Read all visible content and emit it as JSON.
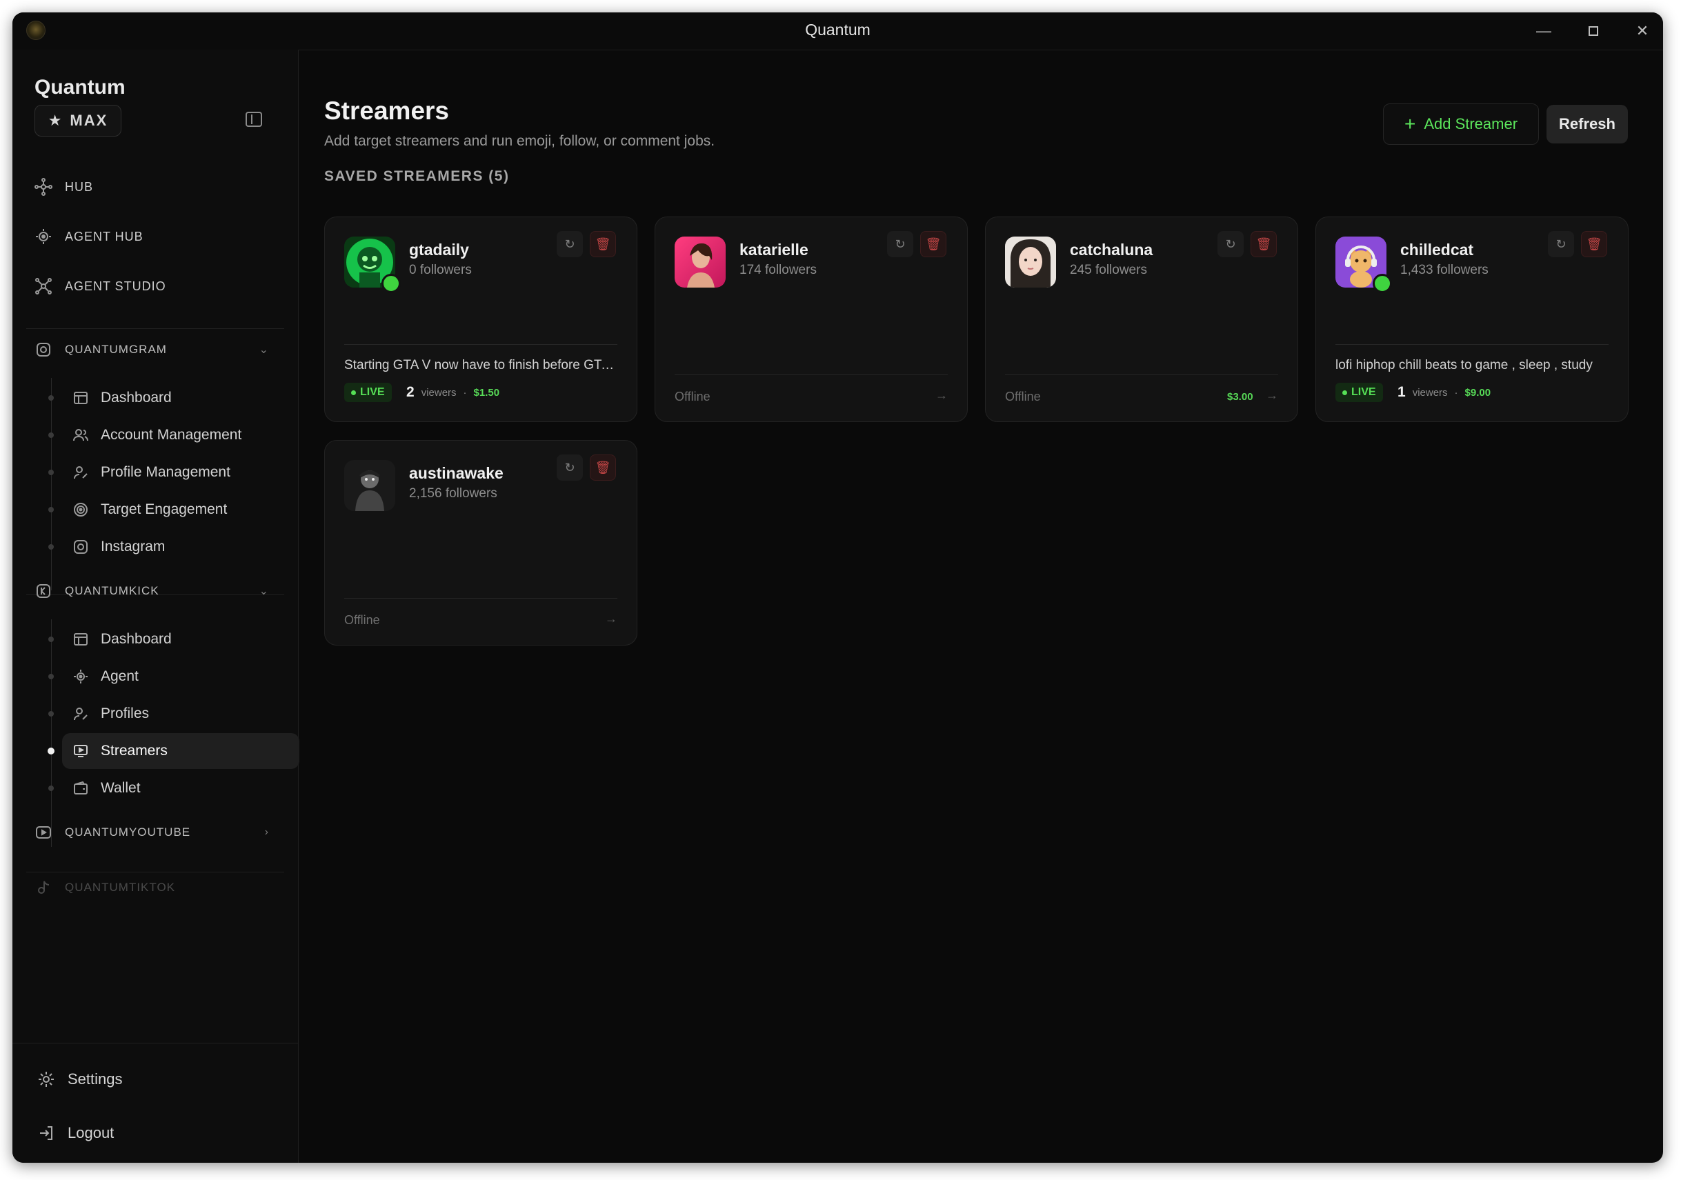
{
  "window": {
    "title": "Quantum",
    "minimize_icon": "minimize-icon",
    "maximize_icon": "maximize-icon",
    "close_icon": "close-icon"
  },
  "sidebar": {
    "brand": "Quantum",
    "plan_badge": "MAX",
    "top_nav": [
      {
        "label": "HUB",
        "icon": "hub-icon"
      },
      {
        "label": "AGENT HUB",
        "icon": "agent-hub-icon"
      },
      {
        "label": "AGENT STUDIO",
        "icon": "agent-studio-icon"
      }
    ],
    "quantumgram": {
      "label": "QUANTUMGRAM",
      "items": [
        "Dashboard",
        "Account Management",
        "Profile Management",
        "Target Engagement",
        "Instagram"
      ]
    },
    "quantumkick": {
      "label": "QUANTUMKICK",
      "items": [
        "Dashboard",
        "Agent",
        "Profiles",
        "Streamers",
        "Wallet"
      ],
      "active": "Streamers"
    },
    "quantumyoutube": {
      "label": "QUANTUMYOUTUBE"
    },
    "quantumtiktok": {
      "label": "QUANTUMTIKTOK"
    },
    "settings": "Settings",
    "logout": "Logout"
  },
  "main": {
    "title": "Streamers",
    "subtitle": "Add target streamers and run emoji, follow, or comment jobs.",
    "add_button": "Add Streamer",
    "refresh_button": "Refresh",
    "section_label": "SAVED STREAMERS (5)",
    "streamers": [
      {
        "name": "gtadaily",
        "followers": "0 followers",
        "live": true,
        "title": "Starting GTA V now have to finish before GTA...",
        "live_label": "LIVE",
        "viewers": "2",
        "viewers_label": "viewers",
        "separator": "·",
        "amount": "$1.50",
        "avatar_color": "#1fd64a"
      },
      {
        "name": "katarielle",
        "followers": "174 followers",
        "live": false,
        "status": "Offline",
        "amount": "",
        "avatar_color": "#e0306a"
      },
      {
        "name": "catchaluna",
        "followers": "245 followers",
        "live": false,
        "status": "Offline",
        "amount": "$3.00",
        "avatar_color": "#c9a99a"
      },
      {
        "name": "chilledcat",
        "followers": "1,433 followers",
        "live": true,
        "title": "lofi hiphop chill beats to game , sleep , study",
        "live_label": "LIVE",
        "viewers": "1",
        "viewers_label": "viewers",
        "separator": "·",
        "amount": "$9.00",
        "avatar_color": "#8a4bd8"
      },
      {
        "name": "austinawake",
        "followers": "2,156 followers",
        "live": false,
        "status": "Offline",
        "amount": "",
        "avatar_color": "#3a3a3a"
      }
    ]
  }
}
